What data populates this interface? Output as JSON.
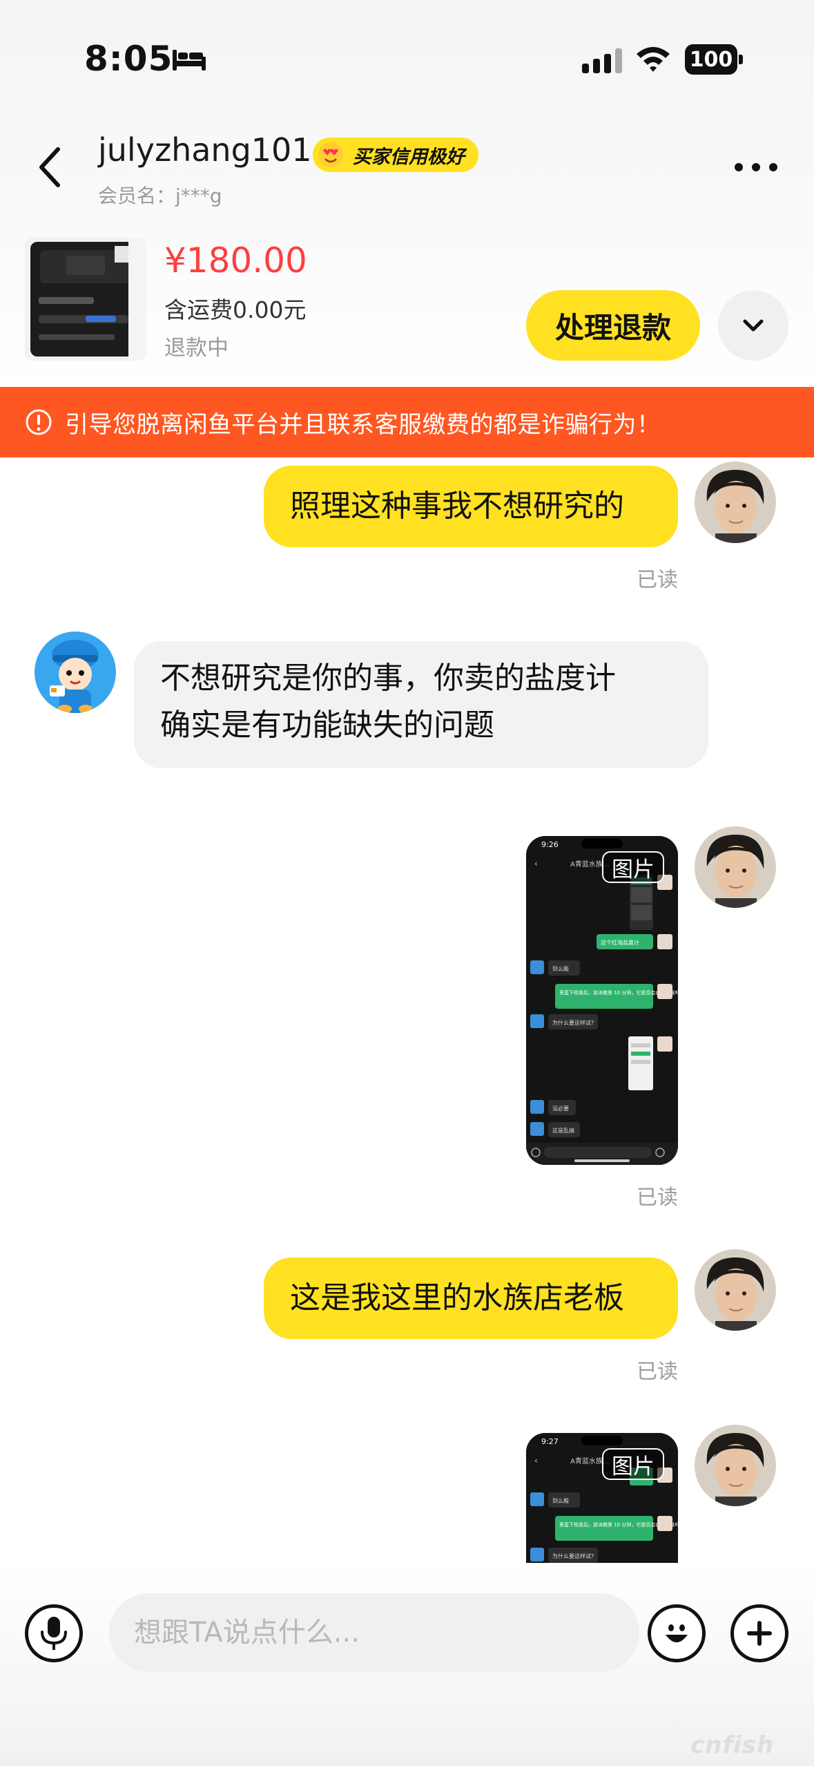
{
  "status_bar": {
    "time": "8:05",
    "battery": "100"
  },
  "header": {
    "username": "julyzhang101",
    "credit_badge": "买家信用极好",
    "member_name": "会员名：j***g"
  },
  "product": {
    "price": "¥180.00",
    "shipping": "含运费0.00元",
    "status": "退款中",
    "refund_button": "处理退款"
  },
  "warning": {
    "text": "引导您脱离闲鱼平台并且联系客服缴费的都是诈骗行为！"
  },
  "messages": [
    {
      "from": "me",
      "type": "text",
      "text": "照理这种事我不想研究的",
      "status": "已读"
    },
    {
      "from": "other",
      "type": "text",
      "line1": "不想研究是你的事，你卖的盐度计",
      "line2": "确实是有功能缺失的问题"
    },
    {
      "from": "me",
      "type": "image",
      "tag": "图片",
      "status": "已读",
      "screenshot": {
        "time": "9:26",
        "title": "A青蓝水族...",
        "texts": [
          "这个红海盐度计",
          "到么殿",
          "里蓝下校准后，放冰箱里 10 分钟，它是否会自动校准吗",
          "为什么要这样试?",
          "没必要",
          "这是乱搞"
        ]
      }
    },
    {
      "from": "me",
      "type": "text",
      "text": "这是我这里的水族店老板",
      "status": "已读"
    },
    {
      "from": "me",
      "type": "image",
      "tag": "图片",
      "screenshot": {
        "time": "9:27",
        "title": "A青蓝水族...",
        "texts": [
          "到么殿",
          "里蓝下校准后，放冰箱里 10 分钟，它是否会自动校准吗",
          "为什么要这样试?"
        ]
      }
    }
  ],
  "input": {
    "placeholder": "想跟TA说点什么..."
  },
  "watermark": "cnfish",
  "colors": {
    "accent_yellow": "#ffe121",
    "price_red": "#ff3e3e",
    "warning_orange": "#ff5722",
    "bubble_gray": "#f2f2f4"
  },
  "icons": [
    "bed-icon",
    "signal-icon",
    "wifi-icon",
    "battery-icon",
    "back-icon",
    "more-icon",
    "chevron-down-icon",
    "alert-circle-icon",
    "mic-icon",
    "emoji-icon",
    "plus-icon"
  ]
}
